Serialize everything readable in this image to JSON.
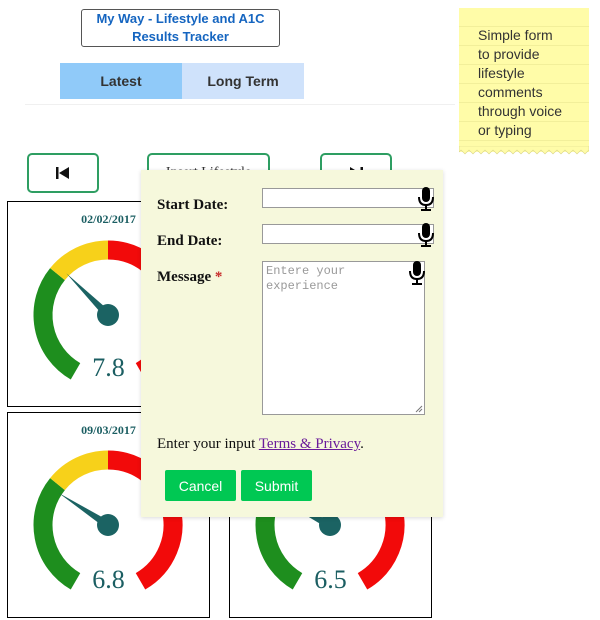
{
  "header": {
    "title_line1": "My Way - Lifestyle and A1C",
    "title_line2": "Results Tracker"
  },
  "tabs": [
    {
      "label": "Latest"
    },
    {
      "label": "Long Term"
    }
  ],
  "note": {
    "lines": [
      "Simple form",
      "to provide",
      "lifestyle",
      "comments",
      "through voice",
      "or typing"
    ]
  },
  "nav": {
    "first_icon": "skip-first-icon",
    "middle_label": "Insert Lifestyle",
    "last_icon": "skip-last-icon"
  },
  "gauges": [
    {
      "date": "02/02/2017",
      "value": "7.8",
      "needle_fraction": 0.35
    },
    {
      "date": "09/03/2017",
      "value": "6.8",
      "needle_fraction": 0.31
    },
    {
      "date": "",
      "value": "6.5",
      "needle_fraction": 0.29
    }
  ],
  "gauge_colors": {
    "green": "#1e8e1e",
    "yellow": "#f7d11a",
    "red": "#f20a0a",
    "needle": "#1b6363"
  },
  "form": {
    "start_label": "Start Date:",
    "end_label": "End Date:",
    "message_label": "Message",
    "required_mark": "*",
    "message_placeholder": "Entere your experience",
    "footer_text": "Enter your input",
    "terms_link": "Terms & Privacy",
    "footer_end": ".",
    "cancel_label": "Cancel",
    "submit_label": "Submit"
  }
}
